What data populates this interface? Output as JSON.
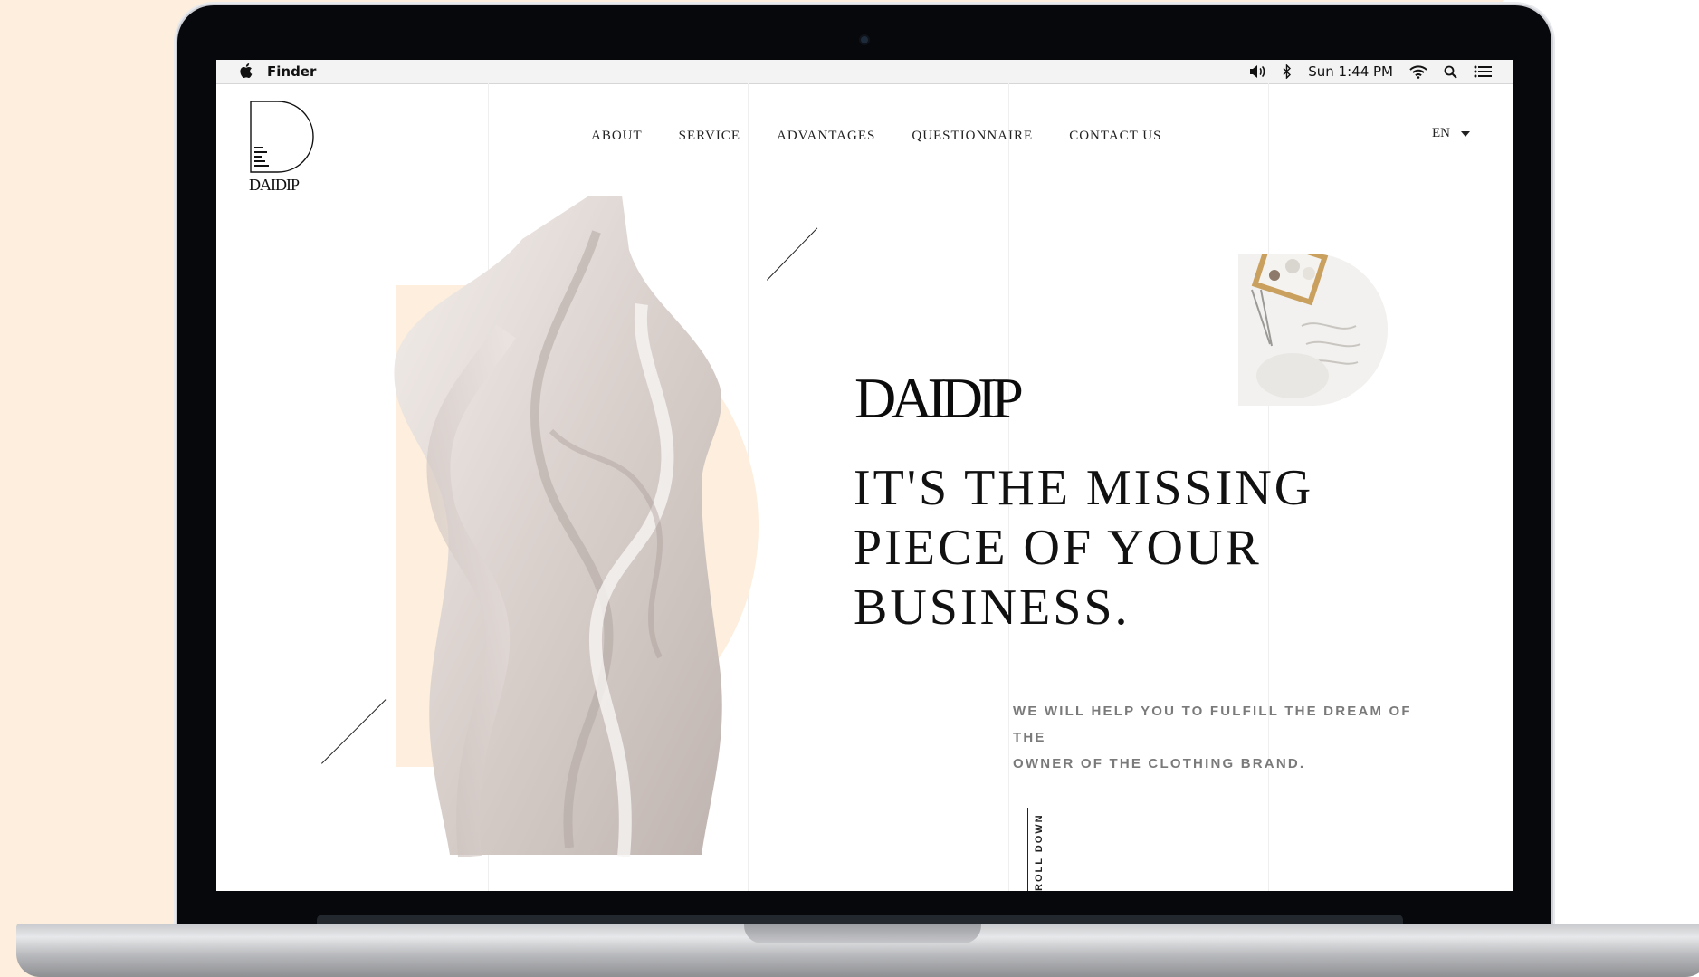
{
  "menubar": {
    "app_name": "Finder",
    "clock": "Sun 1:44 PM"
  },
  "site": {
    "logo_text": "DAIDIP",
    "nav": [
      "ABOUT",
      "SERVICE",
      "ADVANTAGES",
      "QUESTIONNAIRE",
      "CONTACT US"
    ],
    "language": "EN",
    "brand": "DAIDIP",
    "headline_lines": [
      "IT'S THE MISSING",
      "PIECE OF YOUR",
      "BUSINESS."
    ],
    "tagline_lines": [
      "WE WILL HELP YOU TO FULFILL THE DREAM OF THE",
      "OWNER OF THE CLOTHING BRAND."
    ],
    "scroll_label": "ROLL DOWN"
  },
  "colors": {
    "accent_peach": "#fdeedd",
    "ink": "#111111",
    "muted_text": "#7a7a7a"
  },
  "icons": [
    "apple-icon",
    "volume-icon",
    "bluetooth-icon",
    "wifi-icon",
    "spotlight-search-icon",
    "notification-list-icon",
    "chevron-down-icon"
  ]
}
